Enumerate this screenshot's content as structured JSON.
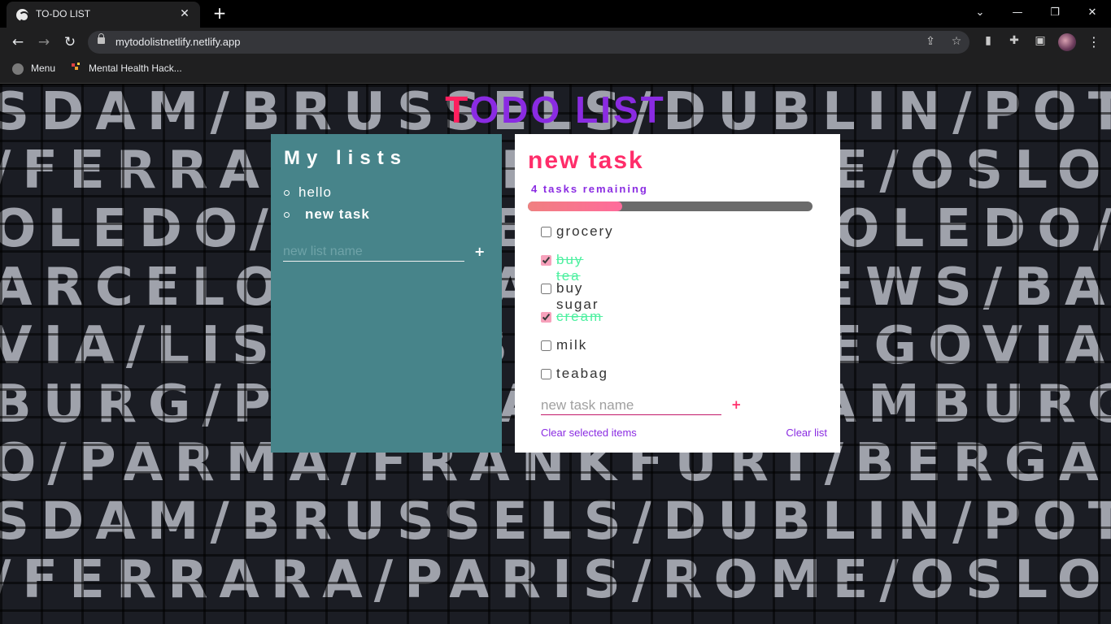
{
  "browser": {
    "tab_title": "TO-DO LIST",
    "url": "mytodolistnetlify.netlify.app",
    "bookmarks": [
      "Menu",
      "Mental Health Hack..."
    ]
  },
  "background": {
    "rows": [
      "SDAM/BRUSSELS/DUBLIN/POTSDAM",
      "/FERRARA/PARIS/ROME/OSLO/FER",
      "OLEDO/AMSTERDAM/TOLEDO/TOLE",
      "ARCELONA/MADRID/NEWS/BARCE",
      "VIA/LISBOA/BERLIN/SEGOVIA",
      "BURG/PISA/NAPOLI/HAMBURG",
      "O/PARMA/FRANKFURT/BERGAMO/PA",
      "SDAM/BRUSSELS/DUBLIN/POTSDAM",
      "/FERRARA/PARIS/ROME/OSLO/FER"
    ]
  },
  "app": {
    "title_first": "T",
    "title_rest": "ODO LIST"
  },
  "lists": {
    "heading": "My lists",
    "items": [
      {
        "label": "hello",
        "active": false
      },
      {
        "label": "new task",
        "active": true
      }
    ],
    "new_list_placeholder": "new list name",
    "add_label": "+"
  },
  "tasks": {
    "title": "new task",
    "remaining": "4 tasks remaining",
    "progress": 0.33,
    "items": [
      {
        "label": "grocery",
        "done": false
      },
      {
        "label": "buy tea",
        "done": true
      },
      {
        "label": "buy sugar",
        "done": false
      },
      {
        "label": "cream",
        "done": true
      },
      {
        "label": "milk",
        "done": false
      },
      {
        "label": "teabag",
        "done": false
      }
    ],
    "new_task_placeholder": "new task name",
    "add_label": "+",
    "clear_selected_label": "Clear selected items",
    "clear_list_label": "Clear list"
  }
}
